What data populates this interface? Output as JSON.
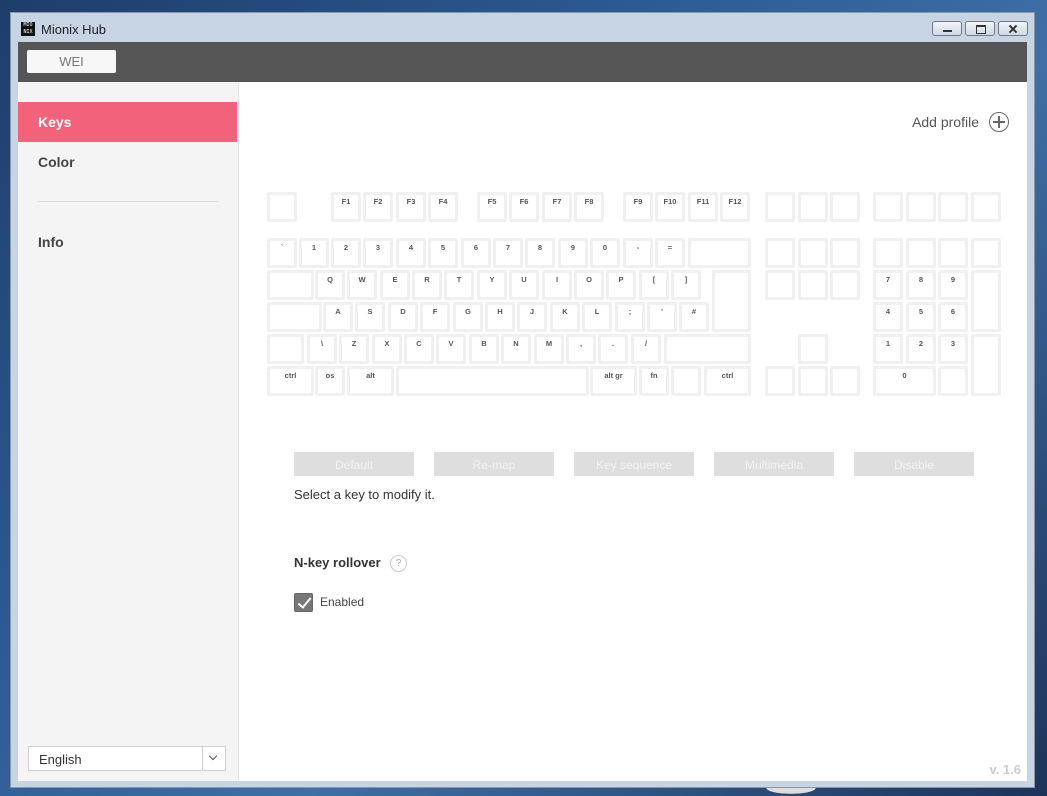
{
  "window": {
    "title": "Mionix Hub",
    "logo_text": "MIO NIX"
  },
  "device": {
    "tab_label": "WEI"
  },
  "sidebar": {
    "items": [
      {
        "label": "Keys",
        "active": true
      },
      {
        "label": "Color",
        "active": false
      },
      {
        "label": "Info",
        "active": false
      }
    ],
    "language": "English"
  },
  "main": {
    "add_profile": "Add profile",
    "actions": [
      "Default",
      "Re-map",
      "Key sequence",
      "Multimedia",
      "Disable"
    ],
    "hint": "Select a key to modify it.",
    "nkey_title": "N-key rollover",
    "help_glyph": "?",
    "enabled_label": "Enabled",
    "enabled_checked": true,
    "version": "v. 1.6"
  },
  "keyboard": {
    "keys": [
      "",
      "F1",
      "F2",
      "F3",
      "F4",
      "F5",
      "F6",
      "F7",
      "F8",
      "F9",
      "F10",
      "F11",
      "F12",
      "",
      "",
      "",
      "",
      "",
      "",
      "",
      "`",
      "1",
      "2",
      "3",
      "4",
      "5",
      "6",
      "7",
      "8",
      "9",
      "0",
      "-",
      "=",
      "",
      "",
      "",
      "",
      "",
      "",
      "",
      "",
      "",
      "Q",
      "W",
      "E",
      "R",
      "T",
      "Y",
      "U",
      "I",
      "O",
      "P",
      "[",
      "]",
      "",
      "",
      "",
      "",
      "7",
      "8",
      "9",
      "",
      "",
      "A",
      "S",
      "D",
      "F",
      "G",
      "H",
      "J",
      "K",
      "L",
      ";",
      "'",
      "#",
      "4",
      "5",
      "6",
      "",
      "\\",
      "Z",
      "X",
      "C",
      "V",
      "B",
      "N",
      "M",
      ",",
      ".",
      "/",
      "",
      "",
      "1",
      "2",
      "3",
      "",
      "ctrl",
      "os",
      "alt",
      "",
      "alt gr",
      "fn",
      "",
      "ctrl",
      "",
      "",
      "",
      "0",
      ""
    ]
  },
  "colors": {
    "accent": "#f2627a",
    "topbar": "#555555"
  }
}
